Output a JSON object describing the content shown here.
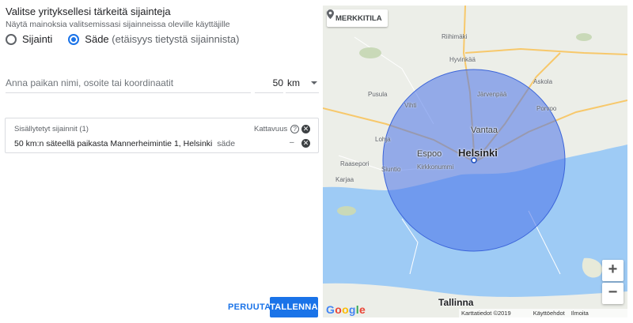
{
  "header": {
    "title": "Valitse yrityksellesi tärkeitä sijainteja",
    "subtitle": "Näytä mainoksia valitsemissasi sijainneissa oleville käyttäjille"
  },
  "mode": {
    "option_location": "Sijainti",
    "option_radius": "Säde",
    "option_radius_hint": "(etäisyys tietystä sijainnista)",
    "selected": "radius"
  },
  "search": {
    "placeholder": "Anna paikan nimi, osoite tai koordinaatit",
    "radius_value": "50",
    "unit": "km"
  },
  "included": {
    "header": "Sisällytetyt sijainnit (1)",
    "coverage_label": "Kattavuus",
    "item_text": "50 km:n säteellä paikasta Mannerheimintie 1, Helsinki",
    "item_type": "säde",
    "coverage_value": "–"
  },
  "actions": {
    "cancel": "PERUUTA",
    "save": "TALLENNA"
  },
  "map": {
    "mode_button": "MERKKITILA",
    "zoom_in": "+",
    "zoom_out": "−",
    "attribution": [
      "Karttatiedot ©2019 Google",
      "Käyttöehdot",
      "Ilmoita karttavirheestä"
    ],
    "places": {
      "riihimaki": "Riihimäki",
      "hyvinkaa": "Hyvinkää",
      "jarvenpaa": "Järvenpää",
      "askola": "Askola",
      "pusula": "Pusula",
      "vihti": "Vihti",
      "porvoo": "Porvoo",
      "lohja": "Lohja",
      "vantaa": "Vantaa",
      "espoo": "Espoo",
      "helsinki": "Helsinki",
      "kirkkonummi": "Kirkkonummi",
      "raasepori": "Raasepori",
      "karjaa": "Karjaa",
      "siuntio": "Siuntio",
      "tallinna": "Tallinna"
    },
    "circle_color": "#4a72e8",
    "water_color": "#9ecbf5"
  }
}
